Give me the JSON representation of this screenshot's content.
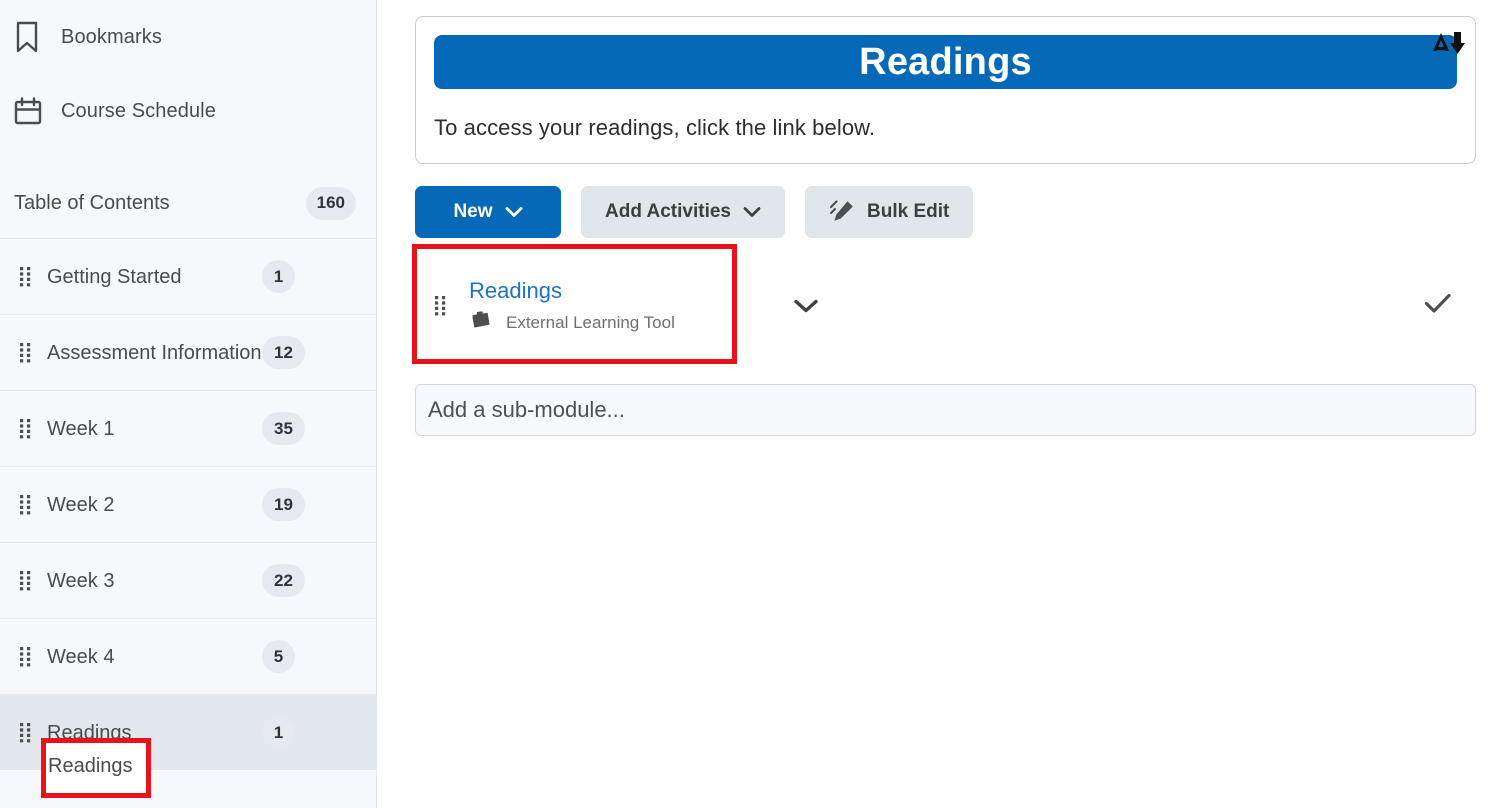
{
  "sidebar": {
    "quick_links": [
      {
        "label": "Bookmarks",
        "icon": "bookmark-icon"
      },
      {
        "label": "Course Schedule",
        "icon": "calendar-icon"
      }
    ],
    "toc": {
      "title": "Table of Contents",
      "count": "160"
    },
    "items": [
      {
        "label": "Getting Started",
        "count": "1",
        "selected": false
      },
      {
        "label": "Assessment Information",
        "count": "12",
        "selected": false
      },
      {
        "label": "Week 1",
        "count": "35",
        "selected": false
      },
      {
        "label": "Week 2",
        "count": "19",
        "selected": false
      },
      {
        "label": "Week 3",
        "count": "22",
        "selected": false
      },
      {
        "label": "Week 4",
        "count": "5",
        "selected": false
      },
      {
        "label": "Readings",
        "count": "1",
        "selected": true
      }
    ],
    "highlight_label": "Readings"
  },
  "main": {
    "description_card": {
      "banner_title": "Readings",
      "body_text": "To access your readings, click the link below.",
      "cursor_icon": "text-cursor-icon"
    },
    "toolbar": {
      "new_label": "New",
      "add_activities_label": "Add Activities",
      "bulk_edit_label": "Bulk Edit",
      "bulk_edit_icon": "pencil-edit-icon",
      "dropdown_icon": "chevron-down-icon"
    },
    "module_row": {
      "title": "Readings",
      "type_label": "External Learning Tool",
      "type_icon": "lti-block-icon",
      "grip_icon": "drag-handle-icon",
      "chevron_icon": "chevron-down-icon",
      "status_icon": "check-icon"
    },
    "add_submodule": {
      "placeholder": "Add a sub-module...",
      "value": ""
    }
  },
  "colors": {
    "accent_blue": "#0669b8",
    "link_blue": "#1e72ca",
    "annotation_red": "#e8131a",
    "sidebar_bg": "#f7f8fb",
    "selected_bg": "#e3e7ee",
    "badge_bg": "#e6eaf0"
  }
}
